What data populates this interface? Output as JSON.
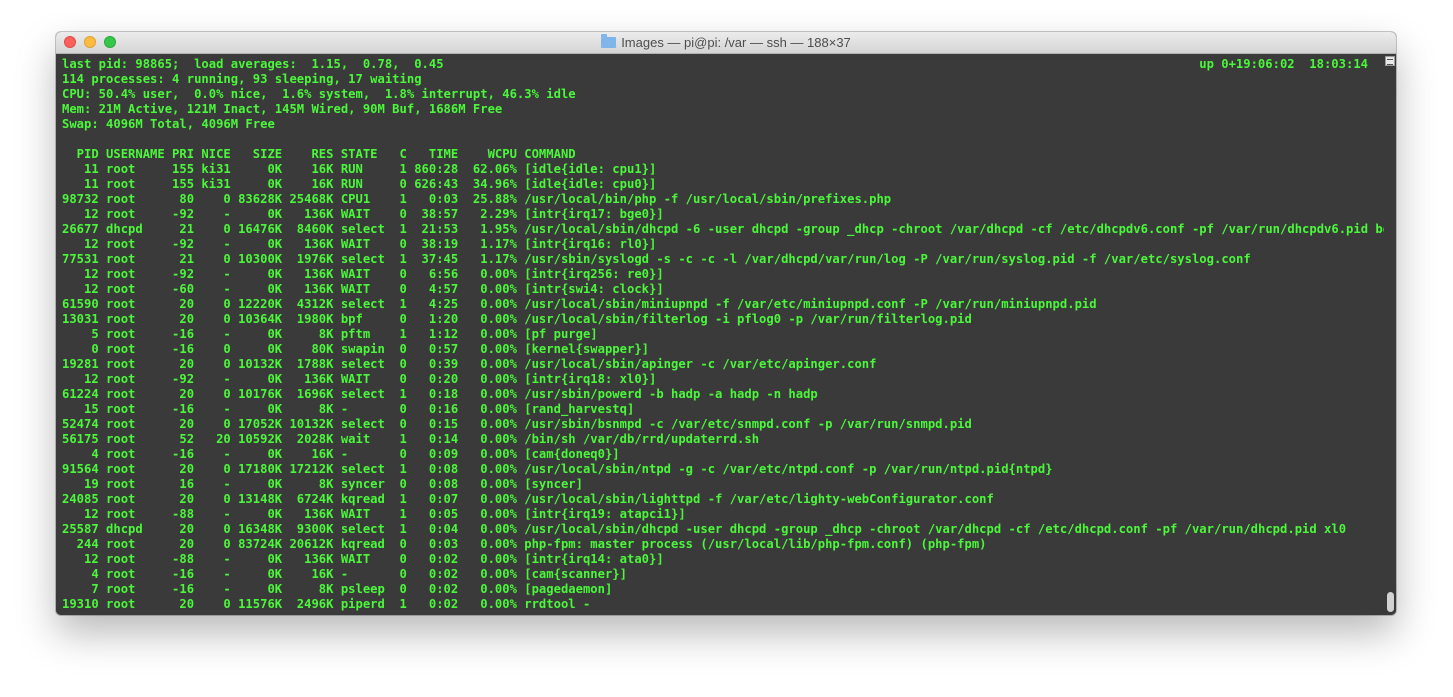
{
  "window": {
    "title": "Images — pi@pi: /var — ssh — 188×37"
  },
  "summary": {
    "lines": [
      "last pid: 98865;  load averages:  1.15,  0.78,  0.45",
      "114 processes: 4 running, 93 sleeping, 17 waiting",
      "CPU: 50.4% user,  0.0% nice,  1.6% system,  1.8% interrupt, 46.3% idle",
      "Mem: 21M Active, 121M Inact, 145M Wired, 90M Buf, 1686M Free",
      "Swap: 4096M Total, 4096M Free"
    ],
    "uptime": "up 0+19:06:02  18:03:14"
  },
  "process_table": {
    "header": "  PID USERNAME PRI NICE   SIZE    RES STATE   C   TIME    WCPU COMMAND",
    "rows": [
      "   11 root     155 ki31     0K    16K RUN     1 860:28  62.06% [idle{idle: cpu1}]",
      "   11 root     155 ki31     0K    16K RUN     0 626:43  34.96% [idle{idle: cpu0}]",
      "98732 root      80    0 83628K 25468K CPU1    1   0:03  25.88% /usr/local/bin/php -f /usr/local/sbin/prefixes.php",
      "   12 root     -92    -     0K   136K WAIT    0  38:57   2.29% [intr{irq17: bge0}]",
      "26677 dhcpd     21    0 16476K  8460K select  1  21:53   1.95% /usr/local/sbin/dhcpd -6 -user dhcpd -group _dhcp -chroot /var/dhcpd -cf /etc/dhcpdv6.conf -pf /var/run/dhcpdv6.pid bge0",
      "   12 root     -92    -     0K   136K WAIT    0  38:19   1.17% [intr{irq16: rl0}]",
      "77531 root      21    0 10300K  1976K select  1  37:45   1.17% /usr/sbin/syslogd -s -c -c -l /var/dhcpd/var/run/log -P /var/run/syslog.pid -f /var/etc/syslog.conf",
      "   12 root     -92    -     0K   136K WAIT    0   6:56   0.00% [intr{irq256: re0}]",
      "   12 root     -60    -     0K   136K WAIT    0   4:57   0.00% [intr{swi4: clock}]",
      "61590 root      20    0 12220K  4312K select  1   4:25   0.00% /usr/local/sbin/miniupnpd -f /var/etc/miniupnpd.conf -P /var/run/miniupnpd.pid",
      "13031 root      20    0 10364K  1980K bpf     0   1:20   0.00% /usr/local/sbin/filterlog -i pflog0 -p /var/run/filterlog.pid",
      "    5 root     -16    -     0K     8K pftm    1   1:12   0.00% [pf purge]",
      "    0 root     -16    0     0K    80K swapin  0   0:57   0.00% [kernel{swapper}]",
      "19281 root      20    0 10132K  1788K select  0   0:39   0.00% /usr/local/sbin/apinger -c /var/etc/apinger.conf",
      "   12 root     -92    -     0K   136K WAIT    0   0:20   0.00% [intr{irq18: xl0}]",
      "61224 root      20    0 10176K  1696K select  1   0:18   0.00% /usr/sbin/powerd -b hadp -a hadp -n hadp",
      "   15 root     -16    -     0K     8K -       0   0:16   0.00% [rand_harvestq]",
      "52474 root      20    0 17052K 10132K select  0   0:15   0.00% /usr/sbin/bsnmpd -c /var/etc/snmpd.conf -p /var/run/snmpd.pid",
      "56175 root      52   20 10592K  2028K wait    1   0:14   0.00% /bin/sh /var/db/rrd/updaterrd.sh",
      "    4 root     -16    -     0K    16K -       0   0:09   0.00% [cam{doneq0}]",
      "91564 root      20    0 17180K 17212K select  1   0:08   0.00% /usr/local/sbin/ntpd -g -c /var/etc/ntpd.conf -p /var/run/ntpd.pid{ntpd}",
      "   19 root      16    -     0K     8K syncer  0   0:08   0.00% [syncer]",
      "24085 root      20    0 13148K  6724K kqread  1   0:07   0.00% /usr/local/sbin/lighttpd -f /var/etc/lighty-webConfigurator.conf",
      "   12 root     -88    -     0K   136K WAIT    1   0:05   0.00% [intr{irq19: atapci1}]",
      "25587 dhcpd     20    0 16348K  9300K select  1   0:04   0.00% /usr/local/sbin/dhcpd -user dhcpd -group _dhcp -chroot /var/dhcpd -cf /etc/dhcpd.conf -pf /var/run/dhcpd.pid xl0",
      "  244 root      20    0 83724K 20612K kqread  0   0:03   0.00% php-fpm: master process (/usr/local/lib/php-fpm.conf) (php-fpm)",
      "   12 root     -88    -     0K   136K WAIT    0   0:02   0.00% [intr{irq14: ata0}]",
      "    4 root     -16    -     0K    16K -       0   0:02   0.00% [cam{scanner}]",
      "    7 root     -16    -     0K     8K psleep  0   0:02   0.00% [pagedaemon]",
      "19310 root      20    0 11576K  2496K piperd  1   0:02   0.00% rrdtool -"
    ]
  }
}
